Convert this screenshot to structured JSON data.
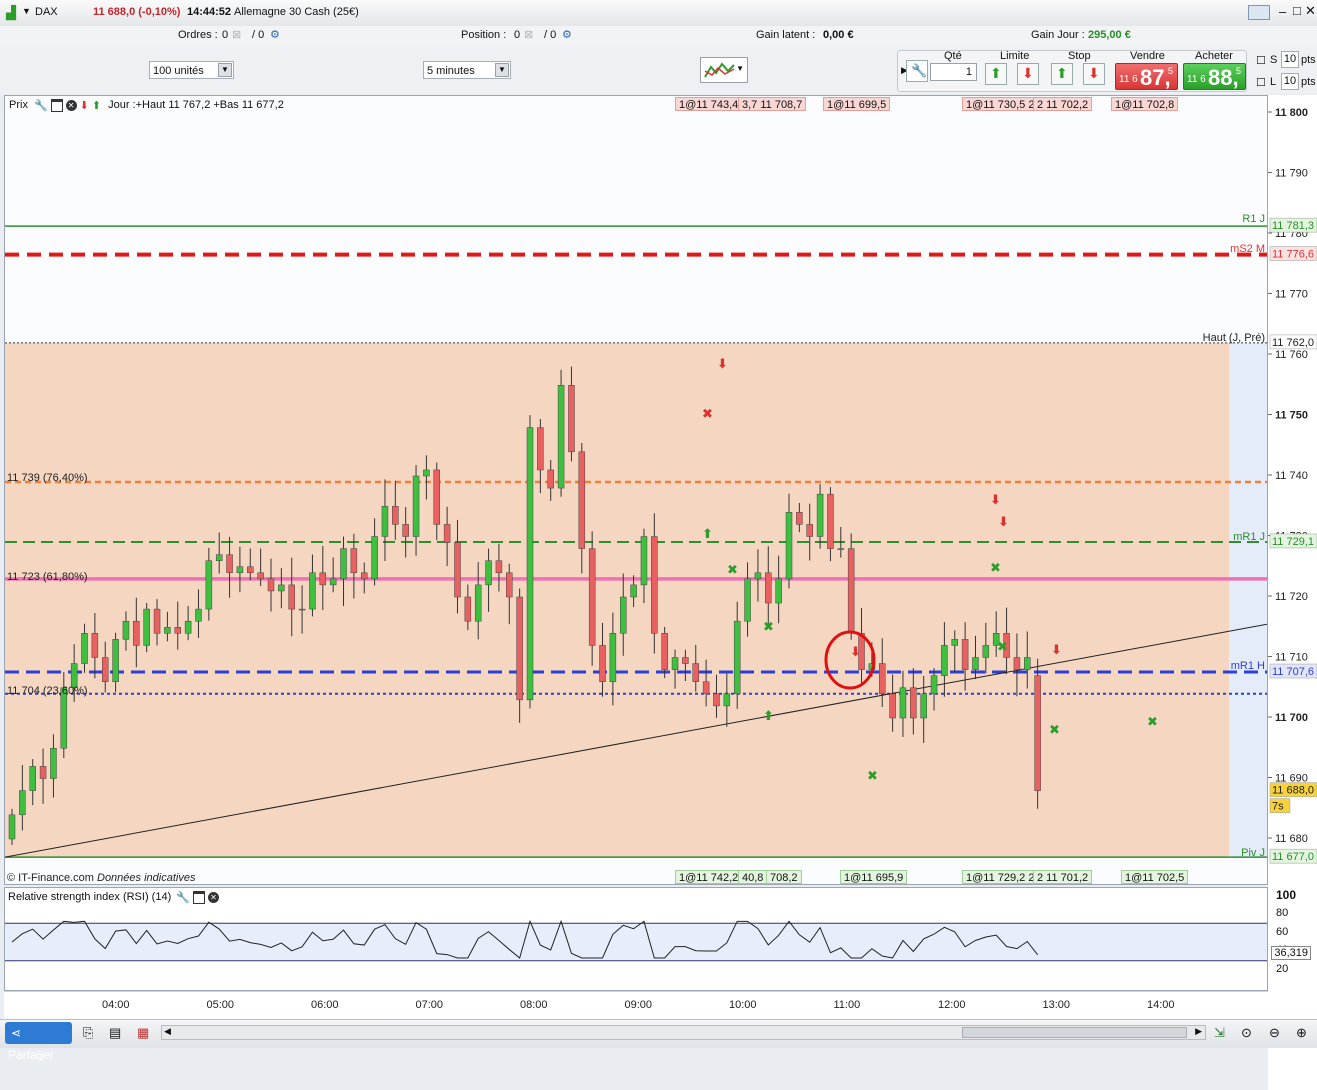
{
  "header": {
    "instrument": "DAX",
    "quote": "11 688,0 (-0,10%)",
    "time": "14:44:52",
    "market": "Allemagne 30 Cash (25€)"
  },
  "account_bar": {
    "orders_label": "Ordres :",
    "orders_value": "0",
    "orders_sep": "/ 0",
    "position_label": "Position :",
    "position_value": "0",
    "position_sep": "/ 0",
    "latent_label": "Gain latent :",
    "latent_value": "0,00 €",
    "day_label": "Gain Jour :",
    "day_value": "295,00 €"
  },
  "toolbar": {
    "units_select": "100 unités",
    "period_select": "5 minutes",
    "qty_label": "Qté",
    "qty_value": "1",
    "limit_label": "Limite",
    "stop_label": "Stop",
    "sell_label": "Vendre",
    "buy_label": "Acheter",
    "sell_prefix": "11 6",
    "sell_big": "87,",
    "sell_sup": "5",
    "buy_prefix": "11 6",
    "buy_big": "88,",
    "buy_sup": "5",
    "s_label": "S",
    "l_label": "L",
    "s_pts": "10",
    "l_pts": "10",
    "pts_label": "pts"
  },
  "chart": {
    "panel_label": "Prix",
    "day_info": "Jour :+Haut 11 767,2 +Bas 11 677,2",
    "copyright": "© IT-Finance.com",
    "disclaimer": "Données indicatives",
    "price_ticks": [
      "11 800",
      "11 790",
      "11 780",
      "11 770",
      "11 760",
      "11 750",
      "11 740",
      "11 730",
      "11 720",
      "11 710",
      "11 700",
      "11 690",
      "11 680"
    ],
    "level_tags": {
      "r1": "11 781,3",
      "ms2": "11 776,6",
      "haut": "11 762,0",
      "mr1j": "11 729,1",
      "mr1h": "11 707,6",
      "last": "11 688,0",
      "countdown": "7s",
      "piv": "11 677,0"
    },
    "level_names": {
      "r1": "R1 J",
      "ms2": "mS2 M",
      "haut": "Haut (J, Pré)",
      "mr1j": "mR1 J",
      "mr1h": "mR1 H",
      "piv": "Piv J"
    },
    "fib_labels": {
      "f764": "11 739 (76,40%)",
      "f618": "11 723 (61,80%)",
      "f236": "11 704 (23,60%)"
    },
    "top_tags": [
      "1@11 743,4",
      "3,7 11 708,7",
      "1@11 699,5",
      "1@11 730,5 2",
      "2 11 702,2",
      "1@11 702,8"
    ],
    "bottom_tags": [
      "1@11 742,2",
      "40,8",
      "708,2",
      "1@11 695,9",
      "1@11 729,2 2",
      "2 11 701,2",
      "1@11 702,5"
    ],
    "time_labels": [
      "04:00",
      "05:00",
      "06:00",
      "07:00",
      "08:00",
      "09:00",
      "10:00",
      "11:00",
      "12:00",
      "13:00",
      "14:00"
    ],
    "colors": {
      "up": "#3fbf3f",
      "down": "#e86060",
      "zone": "#f5d6c1"
    }
  },
  "chart_data": {
    "type": "candlestick",
    "title": "DAX",
    "x_range": [
      "03:35",
      "14:45"
    ],
    "ylim": [
      11675,
      11803
    ],
    "levels": [
      {
        "name": "R1 J",
        "value": 11781.3
      },
      {
        "name": "mS2 M",
        "value": 11776.6
      },
      {
        "name": "Haut (J, Pré)",
        "value": 11762.0
      },
      {
        "name": "11 739 (76,40%)",
        "value": 11739
      },
      {
        "name": "mR1 J",
        "value": 11729.1
      },
      {
        "name": "11 723 (61,80%)",
        "value": 11723
      },
      {
        "name": "mR1 H",
        "value": 11707.6
      },
      {
        "name": "11 704 (23,60%)",
        "value": 11704
      },
      {
        "name": "Piv J",
        "value": 11677.0
      }
    ],
    "last": 11688.0,
    "close_path": [
      11684,
      11688,
      11692,
      11690,
      11695,
      11705,
      11709,
      11714,
      11710,
      11706,
      11713,
      11716,
      11712,
      11718,
      11714,
      11715,
      11714,
      11716,
      11718,
      11726,
      11727,
      11724,
      11725,
      11724,
      11723,
      11721,
      11722,
      11718,
      11718,
      11724,
      11722,
      11723,
      11728,
      11724,
      11723,
      11730,
      11735,
      11732,
      11730,
      11740,
      11741,
      11732,
      11729,
      11720,
      11716,
      11722,
      11726,
      11724,
      11720,
      11703,
      11748,
      11741,
      11738,
      11755,
      11744,
      11728,
      11712,
      11706,
      11714,
      11720,
      11722,
      11730,
      11714,
      11708,
      11710,
      11709,
      11706,
      11704,
      11702,
      11704,
      11716,
      11723,
      11724,
      11719,
      11723,
      11734,
      11732,
      11730,
      11737,
      11728,
      11728,
      11714,
      11708,
      11709,
      11704,
      11700,
      11705,
      11700,
      11704,
      11707,
      11712,
      11713,
      11708,
      11710,
      11712,
      11714,
      11710,
      11708,
      11710,
      11688
    ],
    "rsi": {
      "name": "Relative strength index (RSI) (14)",
      "levels": [
        80,
        60,
        40,
        20
      ],
      "last": 36.319,
      "axis_top": "100"
    }
  },
  "rsi": {
    "label": "Relative strength index (RSI) (14)",
    "ticks": [
      "100",
      "80",
      "60",
      "40",
      "20"
    ],
    "value": "36,319"
  },
  "bottom": {
    "share": "Partager"
  }
}
